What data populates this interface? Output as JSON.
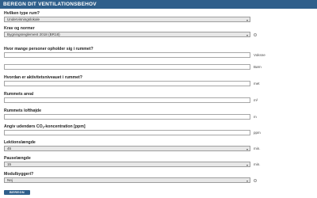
{
  "header": {
    "title": "BEREGN DIT VENTILATIONSBEHOV"
  },
  "fields": {
    "room_type": {
      "label": "Hvilken type rum?",
      "value": "Undervisningslokale"
    },
    "requirements": {
      "label": "Krav og normer",
      "value": "Bygningsreglement 2018 (BR18)"
    },
    "persons": {
      "label": "Hvor mange personer opholder sig i rummet?",
      "adults_value": "",
      "adults_unit": "Voksne",
      "children_value": "",
      "children_unit": "Børn"
    },
    "activity": {
      "label": "Hvordan er aktivitetsniveauet i rummet?",
      "value": "",
      "unit": "met"
    },
    "area": {
      "label": "Rummets areal",
      "value": "",
      "unit": "m²"
    },
    "height": {
      "label": "Rummets lofthøjde",
      "value": "",
      "unit": "m"
    },
    "co2": {
      "label_prefix": "Angiv udendørs CO",
      "label_sub": "2",
      "label_suffix": "-koncentration [ppm]",
      "value": "",
      "unit": "ppm"
    },
    "lesson": {
      "label": "Lektionslængde",
      "value": "45",
      "unit": "min."
    },
    "break": {
      "label": "Pauselængde",
      "value": "15",
      "unit": "min."
    },
    "modular": {
      "label": "Modulbyggeri?",
      "value": "Nej"
    }
  },
  "submit": {
    "label": "BEREGN"
  },
  "icons": {
    "caret": "chevron-down-icon",
    "help": "help-circle-icon"
  },
  "colors": {
    "brand": "#2f5f8b"
  }
}
